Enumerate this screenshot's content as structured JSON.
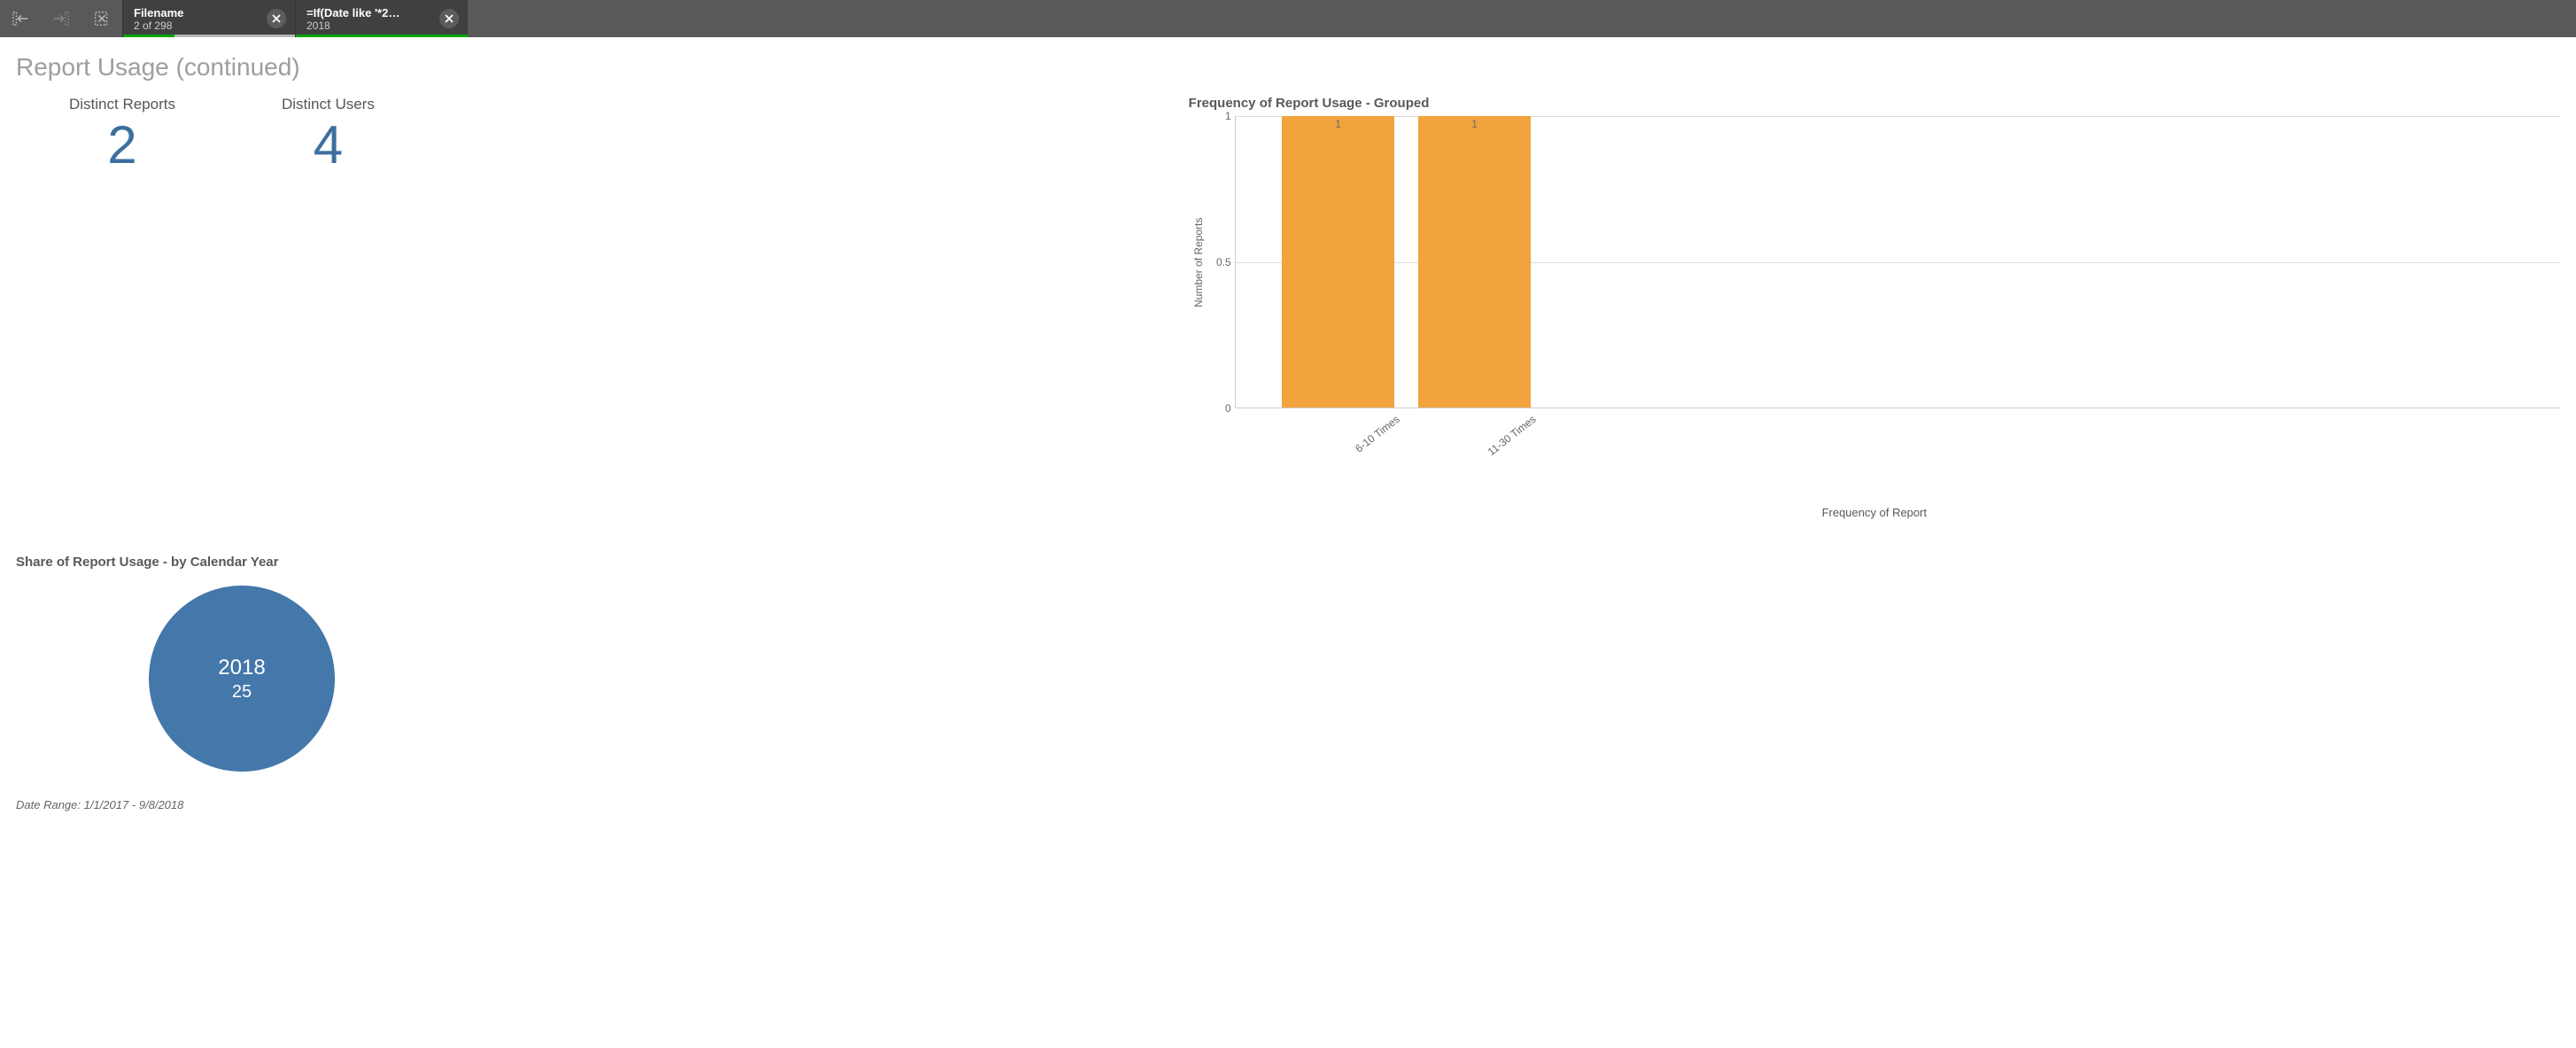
{
  "toolbar": {
    "selections": [
      {
        "title": "Filename",
        "sub": "2 of 298",
        "bar": "partial"
      },
      {
        "title": "=If(Date like '*2…",
        "sub": "2018",
        "bar": "full"
      }
    ]
  },
  "page_title": "Report Usage (continued)",
  "kpi": {
    "distinct_reports": {
      "label": "Distinct Reports",
      "value": "2"
    },
    "distinct_users": {
      "label": "Distinct Users",
      "value": "4"
    }
  },
  "footer_note": "Date Range: 1/1/2017 - 9/8/2018",
  "chart_data": [
    {
      "id": "pie-share-year",
      "type": "pie",
      "title": "Share of Report Usage - by Calendar Year",
      "categories": [
        "2018"
      ],
      "values": [
        25
      ],
      "colors": [
        "#4477aa"
      ]
    },
    {
      "id": "bar-frequency-grouped",
      "type": "bar",
      "title": "Frequency of Report Usage - Grouped",
      "categories": [
        "6-10 Times",
        "11-30 Times"
      ],
      "values": [
        1,
        1
      ],
      "ylabel": "Number of Reports",
      "xlabel": "Frequency of Report",
      "ylim": [
        0,
        1
      ],
      "yticks": [
        0,
        0.5,
        1
      ],
      "color": "#f2a33c"
    }
  ]
}
